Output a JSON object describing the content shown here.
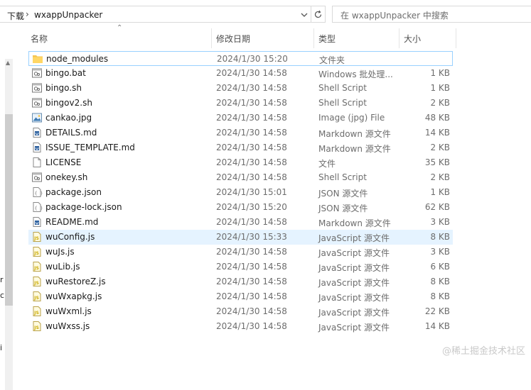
{
  "address_bar": {
    "breadcrumb": [
      "下载",
      "wxappUnpacker"
    ],
    "search_placeholder": "在 wxappUnpacker 中搜索"
  },
  "columns": {
    "name": "名称",
    "date": "修改日期",
    "type": "类型",
    "size": "大小"
  },
  "files": [
    {
      "name": "node_modules",
      "date": "2024/1/30 15:20",
      "type": "文件夹",
      "size": "",
      "icon": "folder-icon"
    },
    {
      "name": "bingo.bat",
      "date": "2024/1/30 14:58",
      "type": "Windows 批处理...",
      "size": "1 KB",
      "icon": "batch-file-icon"
    },
    {
      "name": "bingo.sh",
      "date": "2024/1/30 14:58",
      "type": "Shell Script",
      "size": "1 KB",
      "icon": "shell-script-icon"
    },
    {
      "name": "bingov2.sh",
      "date": "2024/1/30 14:58",
      "type": "Shell Script",
      "size": "2 KB",
      "icon": "shell-script-icon"
    },
    {
      "name": "cankao.jpg",
      "date": "2024/1/30 14:58",
      "type": "Image (jpg) File",
      "size": "48 KB",
      "icon": "image-file-icon"
    },
    {
      "name": "DETAILS.md",
      "date": "2024/1/30 14:58",
      "type": "Markdown 源文件",
      "size": "14 KB",
      "icon": "markdown-file-icon"
    },
    {
      "name": "ISSUE_TEMPLATE.md",
      "date": "2024/1/30 14:58",
      "type": "Markdown 源文件",
      "size": "2 KB",
      "icon": "markdown-file-icon"
    },
    {
      "name": "LICENSE",
      "date": "2024/1/30 14:58",
      "type": "文件",
      "size": "35 KB",
      "icon": "blank-file-icon"
    },
    {
      "name": "onekey.sh",
      "date": "2024/1/30 14:58",
      "type": "Shell Script",
      "size": "2 KB",
      "icon": "shell-script-icon"
    },
    {
      "name": "package.json",
      "date": "2024/1/30 15:01",
      "type": "JSON 源文件",
      "size": "1 KB",
      "icon": "json-file-icon"
    },
    {
      "name": "package-lock.json",
      "date": "2024/1/30 15:20",
      "type": "JSON 源文件",
      "size": "62 KB",
      "icon": "json-file-icon"
    },
    {
      "name": "README.md",
      "date": "2024/1/30 14:58",
      "type": "Markdown 源文件",
      "size": "3 KB",
      "icon": "markdown-file-icon"
    },
    {
      "name": "wuConfig.js",
      "date": "2024/1/30 15:33",
      "type": "JavaScript 源文件",
      "size": "8 KB",
      "icon": "javascript-file-icon"
    },
    {
      "name": "wuJs.js",
      "date": "2024/1/30 14:58",
      "type": "JavaScript 源文件",
      "size": "3 KB",
      "icon": "javascript-file-icon"
    },
    {
      "name": "wuLib.js",
      "date": "2024/1/30 14:58",
      "type": "JavaScript 源文件",
      "size": "6 KB",
      "icon": "javascript-file-icon"
    },
    {
      "name": "wuRestoreZ.js",
      "date": "2024/1/30 14:58",
      "type": "JavaScript 源文件",
      "size": "8 KB",
      "icon": "javascript-file-icon"
    },
    {
      "name": "wuWxapkg.js",
      "date": "2024/1/30 14:58",
      "type": "JavaScript 源文件",
      "size": "8 KB",
      "icon": "javascript-file-icon"
    },
    {
      "name": "wuWxml.js",
      "date": "2024/1/30 14:58",
      "type": "JavaScript 源文件",
      "size": "22 KB",
      "icon": "javascript-file-icon"
    },
    {
      "name": "wuWxss.js",
      "date": "2024/1/30 14:58",
      "type": "JavaScript 源文件",
      "size": "14 KB",
      "icon": "javascript-file-icon"
    }
  ],
  "nav_partial_glyphs": [
    "r",
    "c",
    "i"
  ],
  "watermark": "@稀土掘金技术社区",
  "colors": {
    "selection_border": "#99d1ff",
    "hover_background": "#e5f3ff",
    "folder": "#f5c552",
    "js_icon": "#d4b800"
  }
}
